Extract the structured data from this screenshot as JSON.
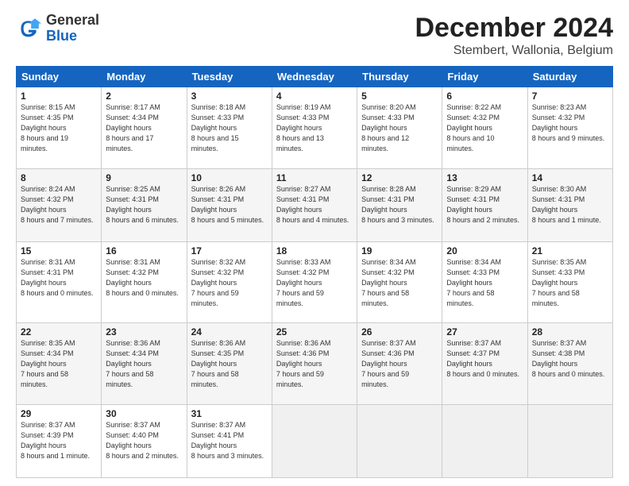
{
  "logo": {
    "general": "General",
    "blue": "Blue"
  },
  "header": {
    "title": "December 2024",
    "subtitle": "Stembert, Wallonia, Belgium"
  },
  "days_of_week": [
    "Sunday",
    "Monday",
    "Tuesday",
    "Wednesday",
    "Thursday",
    "Friday",
    "Saturday"
  ],
  "weeks": [
    [
      {
        "day": "1",
        "sunrise": "8:15 AM",
        "sunset": "4:35 PM",
        "daylight": "8 hours and 19 minutes."
      },
      {
        "day": "2",
        "sunrise": "8:17 AM",
        "sunset": "4:34 PM",
        "daylight": "8 hours and 17 minutes."
      },
      {
        "day": "3",
        "sunrise": "8:18 AM",
        "sunset": "4:33 PM",
        "daylight": "8 hours and 15 minutes."
      },
      {
        "day": "4",
        "sunrise": "8:19 AM",
        "sunset": "4:33 PM",
        "daylight": "8 hours and 13 minutes."
      },
      {
        "day": "5",
        "sunrise": "8:20 AM",
        "sunset": "4:33 PM",
        "daylight": "8 hours and 12 minutes."
      },
      {
        "day": "6",
        "sunrise": "8:22 AM",
        "sunset": "4:32 PM",
        "daylight": "8 hours and 10 minutes."
      },
      {
        "day": "7",
        "sunrise": "8:23 AM",
        "sunset": "4:32 PM",
        "daylight": "8 hours and 9 minutes."
      }
    ],
    [
      {
        "day": "8",
        "sunrise": "8:24 AM",
        "sunset": "4:32 PM",
        "daylight": "8 hours and 7 minutes."
      },
      {
        "day": "9",
        "sunrise": "8:25 AM",
        "sunset": "4:31 PM",
        "daylight": "8 hours and 6 minutes."
      },
      {
        "day": "10",
        "sunrise": "8:26 AM",
        "sunset": "4:31 PM",
        "daylight": "8 hours and 5 minutes."
      },
      {
        "day": "11",
        "sunrise": "8:27 AM",
        "sunset": "4:31 PM",
        "daylight": "8 hours and 4 minutes."
      },
      {
        "day": "12",
        "sunrise": "8:28 AM",
        "sunset": "4:31 PM",
        "daylight": "8 hours and 3 minutes."
      },
      {
        "day": "13",
        "sunrise": "8:29 AM",
        "sunset": "4:31 PM",
        "daylight": "8 hours and 2 minutes."
      },
      {
        "day": "14",
        "sunrise": "8:30 AM",
        "sunset": "4:31 PM",
        "daylight": "8 hours and 1 minute."
      }
    ],
    [
      {
        "day": "15",
        "sunrise": "8:31 AM",
        "sunset": "4:31 PM",
        "daylight": "8 hours and 0 minutes."
      },
      {
        "day": "16",
        "sunrise": "8:31 AM",
        "sunset": "4:32 PM",
        "daylight": "8 hours and 0 minutes."
      },
      {
        "day": "17",
        "sunrise": "8:32 AM",
        "sunset": "4:32 PM",
        "daylight": "7 hours and 59 minutes."
      },
      {
        "day": "18",
        "sunrise": "8:33 AM",
        "sunset": "4:32 PM",
        "daylight": "7 hours and 59 minutes."
      },
      {
        "day": "19",
        "sunrise": "8:34 AM",
        "sunset": "4:32 PM",
        "daylight": "7 hours and 58 minutes."
      },
      {
        "day": "20",
        "sunrise": "8:34 AM",
        "sunset": "4:33 PM",
        "daylight": "7 hours and 58 minutes."
      },
      {
        "day": "21",
        "sunrise": "8:35 AM",
        "sunset": "4:33 PM",
        "daylight": "7 hours and 58 minutes."
      }
    ],
    [
      {
        "day": "22",
        "sunrise": "8:35 AM",
        "sunset": "4:34 PM",
        "daylight": "7 hours and 58 minutes."
      },
      {
        "day": "23",
        "sunrise": "8:36 AM",
        "sunset": "4:34 PM",
        "daylight": "7 hours and 58 minutes."
      },
      {
        "day": "24",
        "sunrise": "8:36 AM",
        "sunset": "4:35 PM",
        "daylight": "7 hours and 58 minutes."
      },
      {
        "day": "25",
        "sunrise": "8:36 AM",
        "sunset": "4:36 PM",
        "daylight": "7 hours and 59 minutes."
      },
      {
        "day": "26",
        "sunrise": "8:37 AM",
        "sunset": "4:36 PM",
        "daylight": "7 hours and 59 minutes."
      },
      {
        "day": "27",
        "sunrise": "8:37 AM",
        "sunset": "4:37 PM",
        "daylight": "8 hours and 0 minutes."
      },
      {
        "day": "28",
        "sunrise": "8:37 AM",
        "sunset": "4:38 PM",
        "daylight": "8 hours and 0 minutes."
      }
    ],
    [
      {
        "day": "29",
        "sunrise": "8:37 AM",
        "sunset": "4:39 PM",
        "daylight": "8 hours and 1 minute."
      },
      {
        "day": "30",
        "sunrise": "8:37 AM",
        "sunset": "4:40 PM",
        "daylight": "8 hours and 2 minutes."
      },
      {
        "day": "31",
        "sunrise": "8:37 AM",
        "sunset": "4:41 PM",
        "daylight": "8 hours and 3 minutes."
      },
      null,
      null,
      null,
      null
    ]
  ]
}
